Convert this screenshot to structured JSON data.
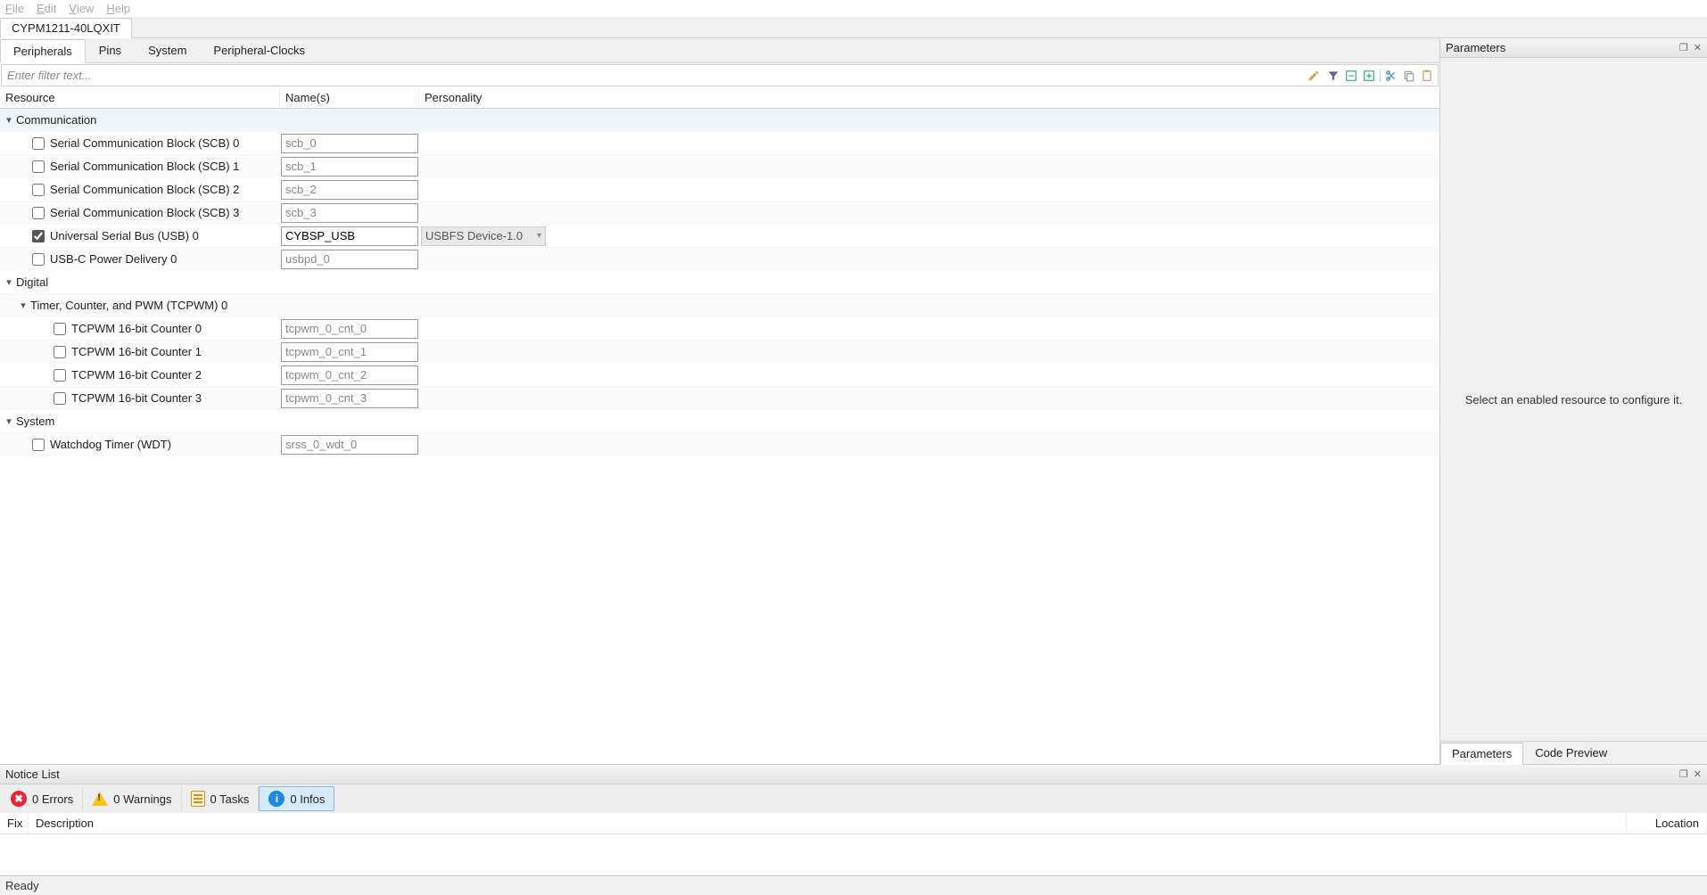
{
  "menu": {
    "file": "File",
    "edit": "Edit",
    "view": "View",
    "help": "Help"
  },
  "device_tab": "CYPM1211-40LQXIT",
  "config_tabs": [
    "Peripherals",
    "Pins",
    "System",
    "Peripheral-Clocks"
  ],
  "filter_placeholder": "Enter filter text...",
  "columns": {
    "resource": "Resource",
    "names": "Name(s)",
    "personality": "Personality"
  },
  "groups": {
    "communication": {
      "label": "Communication",
      "items": [
        {
          "label": "Serial Communication Block (SCB) 0",
          "name": "scb_0",
          "checked": false
        },
        {
          "label": "Serial Communication Block (SCB) 1",
          "name": "scb_1",
          "checked": false
        },
        {
          "label": "Serial Communication Block (SCB) 2",
          "name": "scb_2",
          "checked": false
        },
        {
          "label": "Serial Communication Block (SCB) 3",
          "name": "scb_3",
          "checked": false
        },
        {
          "label": "Universal Serial Bus (USB) 0",
          "name": "CYBSP_USB",
          "checked": true,
          "personality": "USBFS Device-1.0"
        },
        {
          "label": "USB-C Power Delivery 0",
          "name": "usbpd_0",
          "checked": false
        }
      ]
    },
    "digital": {
      "label": "Digital",
      "subgroup_label": "Timer, Counter, and PWM (TCPWM) 0",
      "items": [
        {
          "label": "TCPWM 16-bit Counter 0",
          "name": "tcpwm_0_cnt_0",
          "checked": false
        },
        {
          "label": "TCPWM 16-bit Counter 1",
          "name": "tcpwm_0_cnt_1",
          "checked": false
        },
        {
          "label": "TCPWM 16-bit Counter 2",
          "name": "tcpwm_0_cnt_2",
          "checked": false
        },
        {
          "label": "TCPWM 16-bit Counter 3",
          "name": "tcpwm_0_cnt_3",
          "checked": false
        }
      ]
    },
    "system": {
      "label": "System",
      "items": [
        {
          "label": "Watchdog Timer (WDT)",
          "name": "srss_0_wdt_0",
          "checked": false
        }
      ]
    }
  },
  "right_panel": {
    "title": "Parameters",
    "placeholder": "Select an enabled resource to configure it.",
    "tabs": [
      "Parameters",
      "Code Preview"
    ]
  },
  "notice": {
    "title": "Notice List",
    "filters": {
      "errors": "0 Errors",
      "warnings": "0 Warnings",
      "tasks": "0 Tasks",
      "infos": "0 Infos"
    },
    "cols": {
      "fix": "Fix",
      "desc": "Description",
      "loc": "Location"
    }
  },
  "status": "Ready"
}
